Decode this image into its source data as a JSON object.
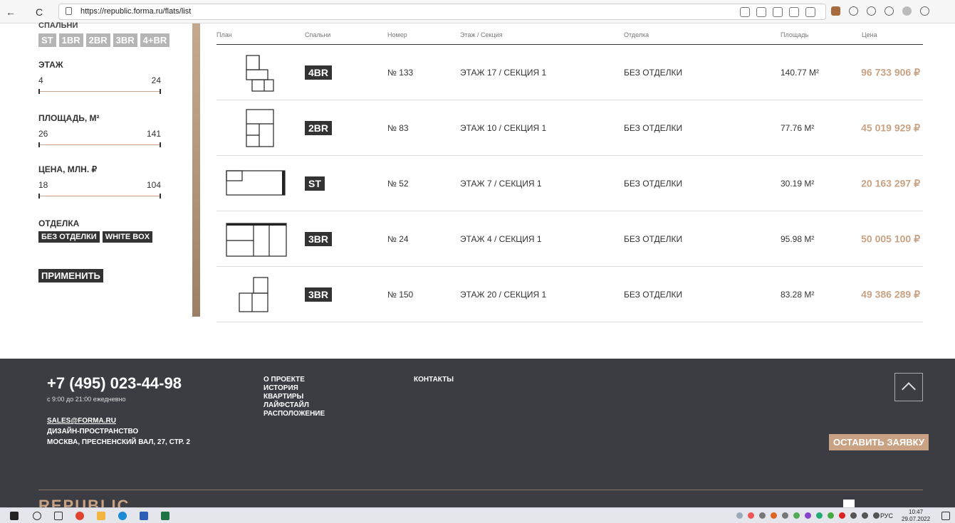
{
  "browser": {
    "url": "https://republic.forma.ru/flats/list",
    "back": "←",
    "refresh": "C"
  },
  "filters": {
    "bedrooms_label": "СПАЛЬНИ",
    "bedrooms": [
      "ST",
      "1BR",
      "2BR",
      "3BR",
      "4+BR"
    ],
    "floor": {
      "label": "ЭТАЖ",
      "min": "4",
      "max": "24"
    },
    "area": {
      "label": "ПЛОЩАДЬ, М²",
      "min": "26",
      "max": "141"
    },
    "price": {
      "label": "ЦЕНА, МЛН. ₽",
      "min": "18",
      "max": "104"
    },
    "finish_label": "ОТДЕЛКА",
    "finishes": [
      "БЕЗ ОТДЕЛКИ",
      "WHITE BOX"
    ],
    "apply": "ПРИМЕНИТЬ"
  },
  "table": {
    "headers": {
      "plan": "План",
      "bedrooms": "Спальни",
      "number": "Номер",
      "floor": "Этаж / Секция",
      "finish": "Отделка",
      "area": "Площадь",
      "price": "Цена"
    },
    "rows": [
      {
        "bedrooms": "4BR",
        "number": "№ 133",
        "floor": "ЭТАЖ 17 / СЕКЦИЯ 1",
        "finish": "БЕЗ ОТДЕЛКИ",
        "area": "140.77 М²",
        "price": "96 733 906 ₽"
      },
      {
        "bedrooms": "2BR",
        "number": "№ 83",
        "floor": "ЭТАЖ 10 / СЕКЦИЯ 1",
        "finish": "БЕЗ ОТДЕЛКИ",
        "area": "77.76 М²",
        "price": "45 019 929 ₽"
      },
      {
        "bedrooms": "ST",
        "number": "№ 52",
        "floor": "ЭТАЖ 7 / СЕКЦИЯ 1",
        "finish": "БЕЗ ОТДЕЛКИ",
        "area": "30.19 М²",
        "price": "20 163 297 ₽"
      },
      {
        "bedrooms": "3BR",
        "number": "№ 24",
        "floor": "ЭТАЖ 4 / СЕКЦИЯ 1",
        "finish": "БЕЗ ОТДЕЛКИ",
        "area": "95.98 М²",
        "price": "50 005 100 ₽"
      },
      {
        "bedrooms": "3BR",
        "number": "№ 150",
        "floor": "ЭТАЖ 20 / СЕКЦИЯ 1",
        "finish": "БЕЗ ОТДЕЛКИ",
        "area": "83.28 М²",
        "price": "49 386 289 ₽"
      }
    ]
  },
  "footer": {
    "phone": "+7 (495) 023-44-98",
    "hours": "с 9:00 до 21:00 ежедневно",
    "email": "SALES@FORMA.RU",
    "address_line1": "ДИЗАЙН-ПРОСТРАНСТВО",
    "address_line2": "МОСКВА, ПРЕСНЕНСКИЙ ВАЛ, 27, СТР. 2",
    "menu": [
      "О ПРОЕКТЕ",
      "ИСТОРИЯ",
      "КВАРТИРЫ",
      "ЛАЙФСТАЙЛ",
      "РАСПОЛОЖЕНИЕ"
    ],
    "contacts": "КОНТАКТЫ",
    "request_button": "ОСТАВИТЬ ЗАЯВКУ",
    "logo": "REPUBLIC"
  },
  "taskbar": {
    "language": "РУС",
    "time": "10:47",
    "date": "29.07.2022"
  },
  "colors": {
    "accent": "#c9a284",
    "dark": "#333333",
    "footer_bg": "#3b3d42"
  }
}
